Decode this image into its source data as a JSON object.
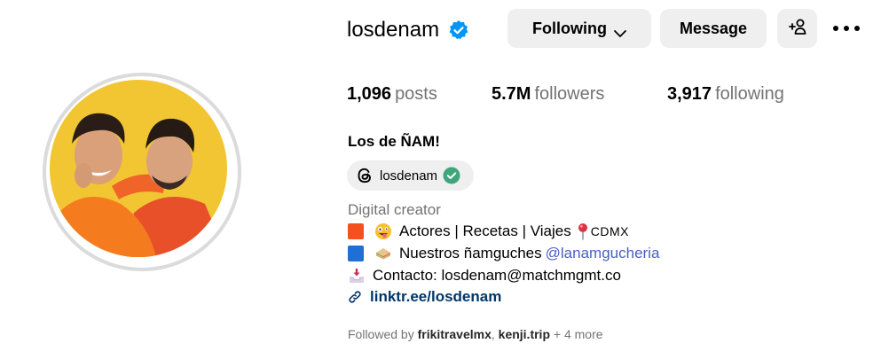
{
  "profile": {
    "username": "losdenam",
    "verified": true,
    "buttons": {
      "following_label": "Following",
      "message_label": "Message",
      "add_user_icon": "person-add-icon",
      "more_icon": "more-options-icon"
    },
    "stats": {
      "posts_count": "1,096",
      "posts_label": "posts",
      "followers_count": "5.7M",
      "followers_label": "followers",
      "following_count": "3,917",
      "following_label": "following"
    },
    "full_name": "Los de ÑAM!",
    "threads": {
      "handle": "losdenam",
      "icon": "threads-icon"
    },
    "category": "Digital creator",
    "bio": {
      "line1_text": "Actores | Recetas | Viajes",
      "line1_suffix": "CDMX",
      "line2_text": "Nuestros ñamguches",
      "line2_mention": "@lanamgucheria",
      "line3_text": "Contacto: losdenam@matchmgmt.co"
    },
    "link": "linktr.ee/losdenam",
    "followed_by": {
      "prefix": "Followed by",
      "user1": "frikitravelmx",
      "separator": ",",
      "user2": "kenji.trip",
      "more": "+ 4 more"
    }
  },
  "colors": {
    "accent_blue": "#0095f6",
    "mention": "#4a5fc1",
    "link": "#00376b",
    "button_bg": "#efefef",
    "secondary_text": "#737373",
    "threads_check": "#3fa57a"
  }
}
